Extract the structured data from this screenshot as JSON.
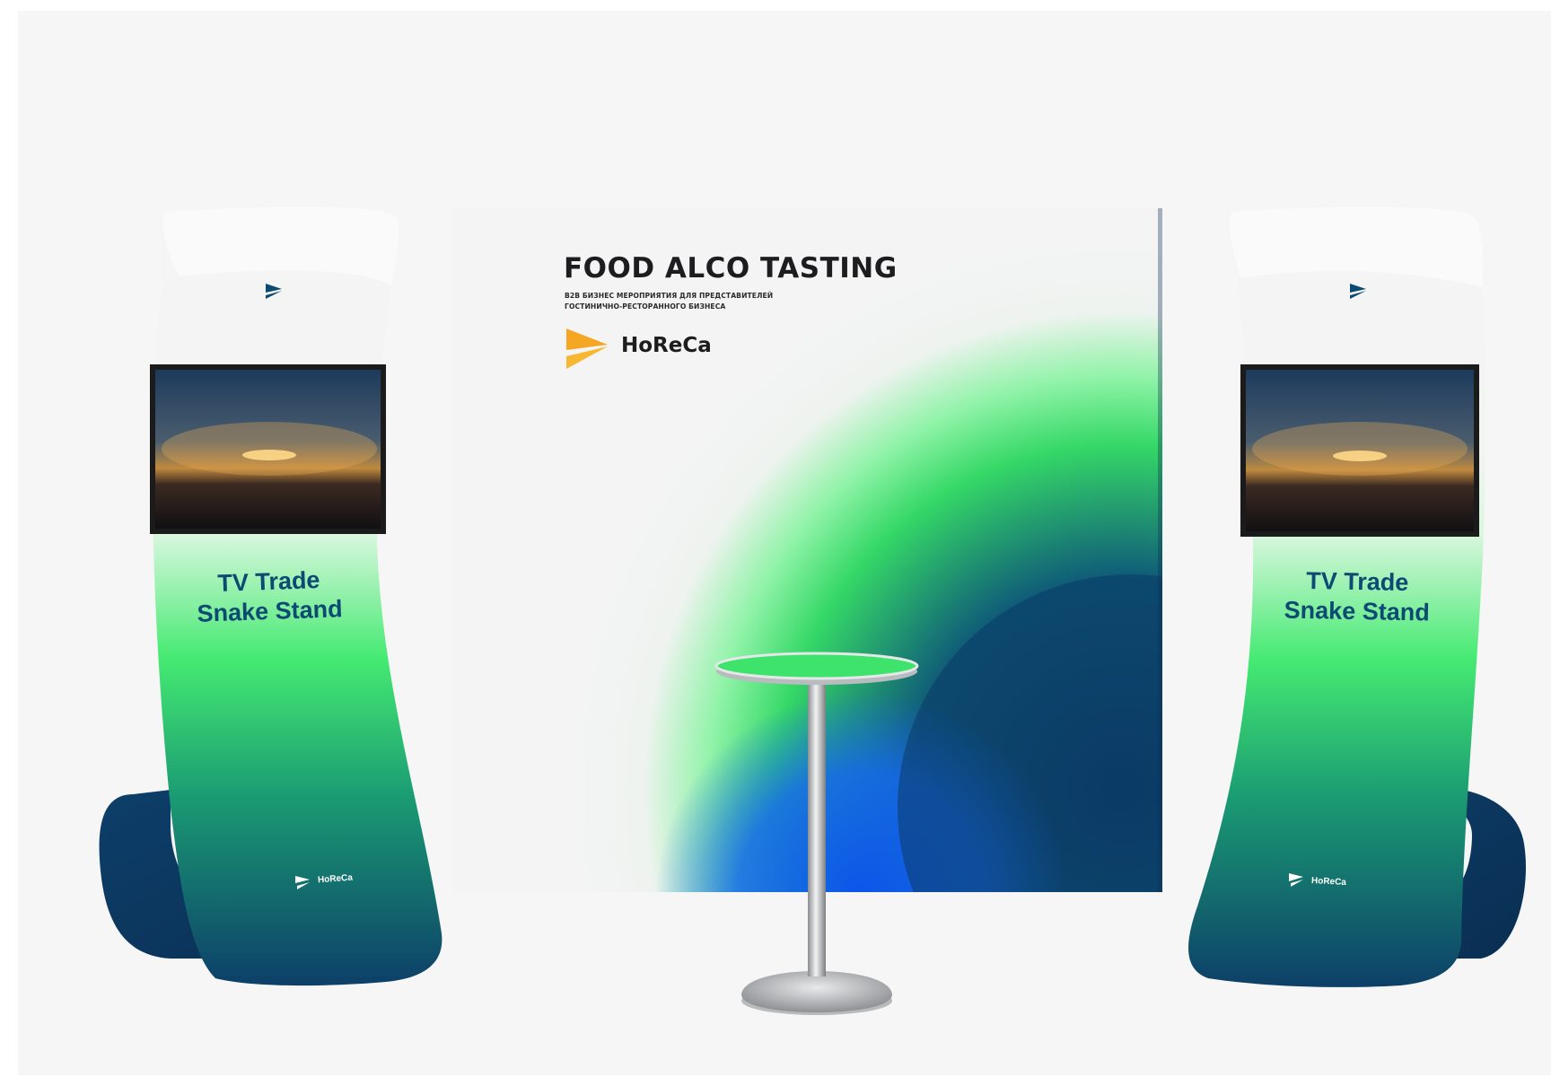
{
  "banner": {
    "title": "FOOD ALCO TASTING",
    "subtitle_line1": "B2B БИЗНЕС МЕРОПРИЯТИЯ ДЛЯ ПРЕДСТАВИТЕЛЕЙ",
    "subtitle_line2": "ГОСТИНИЧНО-РЕСТОРАННОГО БИЗНЕСА",
    "brand": "HoReCa"
  },
  "stands": [
    {
      "caption_line1": "TV Trade",
      "caption_line2": "Snake Stand",
      "brand": "HoReCa"
    },
    {
      "caption_line1": "TV Trade",
      "caption_line2": "Snake Stand",
      "brand": "HoReCa"
    }
  ],
  "colors": {
    "background": "#f6f6f6",
    "accent_green": "#3fe86a",
    "accent_blue": "#0a5fe8",
    "navy": "#0d3d68",
    "logo_orange": "#f5a623"
  }
}
